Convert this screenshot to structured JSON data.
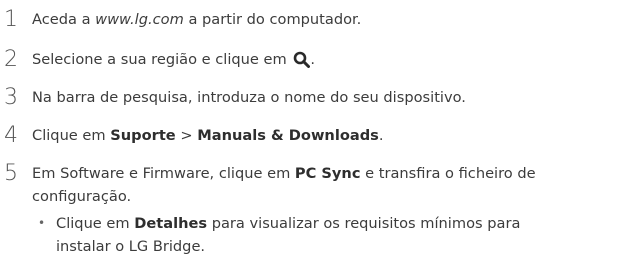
{
  "steps": [
    {
      "number": "1",
      "pre": "Aceda a ",
      "link": "www.lg.com",
      "post": " a partir do computador."
    },
    {
      "number": "2",
      "pre": "Selecione a sua região e clique em ",
      "icon": "search-icon",
      "post": "."
    },
    {
      "number": "3",
      "text": "Na barra de pesquisa, introduza o nome do seu dispositivo."
    },
    {
      "number": "4",
      "pre": "Clique em ",
      "bold1": "Suporte",
      "sep": " > ",
      "bold2": "Manuals & Downloads",
      "post": "."
    },
    {
      "number": "5",
      "pre": "Em Software e Firmware, clique em ",
      "bold": "PC Sync",
      "post_line1": " e transfira o ficheiro de",
      "line2": "configuração."
    }
  ],
  "bullet": {
    "pre": "Clique em ",
    "bold": "Detalhes",
    "post_line1": " para visualizar os requisitos mínimos para",
    "line2": "instalar o LG Bridge."
  }
}
